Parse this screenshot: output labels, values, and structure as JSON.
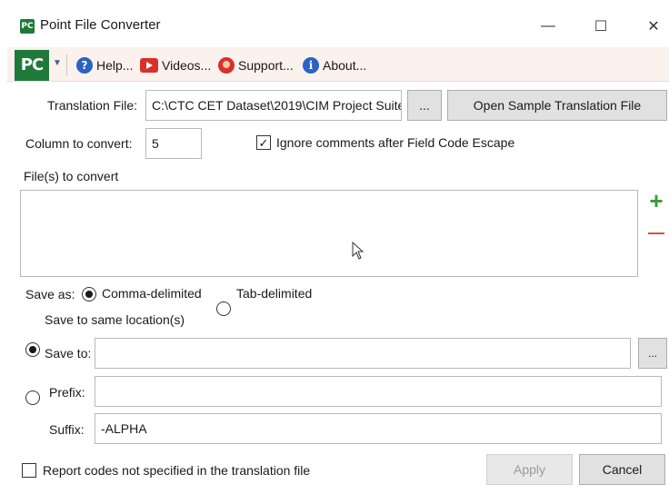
{
  "window": {
    "title": "Point File Converter",
    "app_icon_text": "PC",
    "controls": {
      "minimize": "—",
      "maximize": "☐",
      "close": "✕"
    }
  },
  "toolbar": {
    "logo_text": "PC",
    "help": "Help...",
    "videos": "Videos...",
    "support": "Support...",
    "about": "About..."
  },
  "translation": {
    "label": "Translation File:",
    "value": "C:\\CTC CET Dataset\\2019\\CIM Project Suite",
    "browse": "...",
    "open_sample": "Open Sample Translation File"
  },
  "column": {
    "label": "Column to convert:",
    "value": "5"
  },
  "ignore_comments": {
    "label": "Ignore comments after Field Code Escape",
    "checked": true
  },
  "files": {
    "label": "File(s) to convert",
    "add": "+",
    "remove": "—"
  },
  "save_as": {
    "label": "Save as:",
    "options": [
      "Comma-delimited",
      "Tab-delimited"
    ],
    "selected": "Comma-delimited"
  },
  "location": {
    "same_label": "Save to same location(s)",
    "save_to_label": "Save to:",
    "save_to_value": "",
    "browse": "...",
    "selected": "same"
  },
  "prefix": {
    "label": "Prefix:",
    "value": ""
  },
  "suffix": {
    "label": "Suffix:",
    "value": "-ALPHA"
  },
  "report": {
    "label": "Report codes not specified in the translation file",
    "checked": false
  },
  "actions": {
    "apply": "Apply",
    "cancel": "Cancel"
  },
  "colors": {
    "brand_green": "#1f7a3a",
    "toolbar_bg": "#fbf1ed",
    "add_green": "#3a9a3a",
    "remove_red": "#d9453a"
  }
}
